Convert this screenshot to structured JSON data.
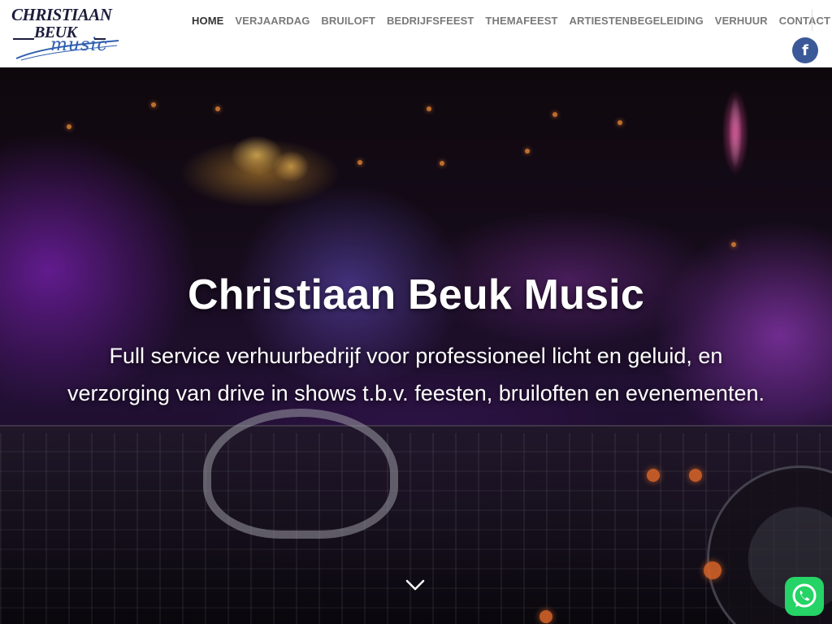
{
  "brand": {
    "logo_line1": "CHRISTIAAN",
    "logo_line2": "BEUK",
    "logo_line3": "music"
  },
  "nav": {
    "items": [
      {
        "label": "HOME",
        "active": true
      },
      {
        "label": "VERJAARDAG"
      },
      {
        "label": "BRUILOFT"
      },
      {
        "label": "BEDRIJFSFEEST"
      },
      {
        "label": "THEMAFEEST"
      },
      {
        "label": "ARTIESTENBEGELEIDING"
      },
      {
        "label": "VERHUUR"
      },
      {
        "label": "CONTACT"
      }
    ]
  },
  "social": {
    "facebook_glyph": "f",
    "facebook_color": "#3b5998"
  },
  "hero": {
    "title": "Christiaan Beuk Music",
    "subtitle_line1": "Full service verhuurbedrijf voor professioneel licht en geluid, en",
    "subtitle_line2": "verzorging van drive in shows t.b.v. feesten, bruiloften en evenementen.",
    "scroll_icon": "chevron-down-icon"
  },
  "floating": {
    "whatsapp_icon": "whatsapp-icon",
    "whatsapp_color": "#25d366"
  }
}
